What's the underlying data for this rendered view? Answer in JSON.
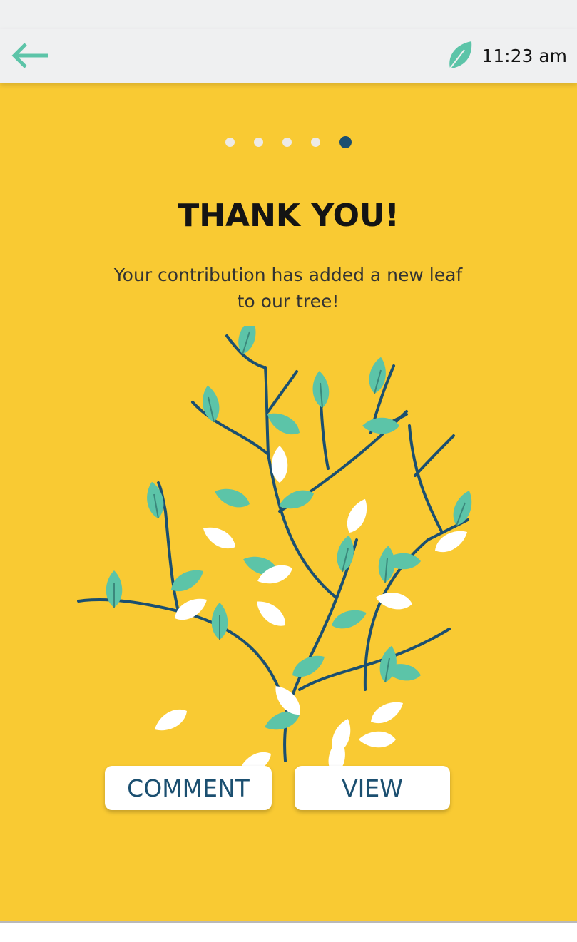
{
  "colors": {
    "header_bg": "#eff0f1",
    "accent_green": "#5cc4a8",
    "background_yellow": "#f9ca33",
    "navy": "#1b4f70",
    "dot_inactive": "#edeae6"
  },
  "header": {
    "back_icon": "arrow-left-icon",
    "status_icon": "leaf-icon",
    "time": "11:23 am"
  },
  "pager": {
    "count": 5,
    "active_index": 4
  },
  "content": {
    "title": "THANK YOU!",
    "message_line1": "Your contribution has added a new leaf",
    "message_line2": "to our tree!",
    "illustration": "tree-illustration"
  },
  "actions": {
    "comment_label": "COMMENT",
    "view_label": "VIEW"
  }
}
